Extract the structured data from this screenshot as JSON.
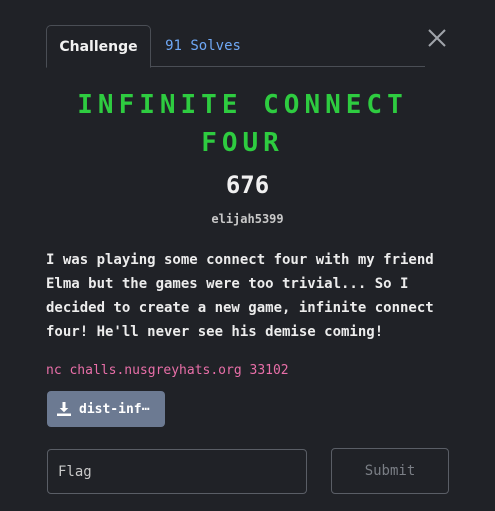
{
  "tabs": {
    "challenge_label": "Challenge",
    "solves_label": "91 Solves"
  },
  "challenge": {
    "title": "INFINITE CONNECT FOUR",
    "points": "676",
    "author": "elijah5399",
    "description": "I was playing some connect four with my friend Elma but the games were too trivial... So I decided to create a new game, infinite connect four! He'll never see his demise coming!",
    "connection": "nc challs.nusgreyhats.org 33102",
    "file_label": "dist-inf⋯"
  },
  "form": {
    "flag_placeholder": "Flag",
    "submit_label": "Submit"
  },
  "icons": {
    "close": "close-icon",
    "download": "download-icon"
  },
  "colors": {
    "background": "#202227",
    "title": "#2ecc40",
    "solves": "#6fa8f5",
    "connection": "#e86fa8",
    "download_button": "#6c7a92"
  }
}
